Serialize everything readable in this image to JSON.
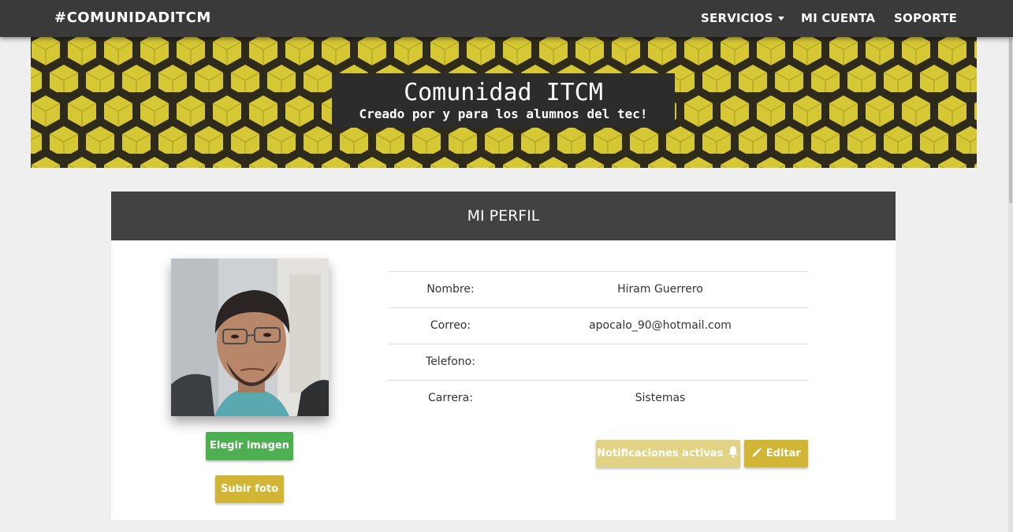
{
  "navbar": {
    "brand": "#COMUNIDADITCM",
    "items": [
      {
        "label": "SERVICIOS",
        "has_caret": true
      },
      {
        "label": "MI CUENTA"
      },
      {
        "label": "SOPORTE"
      }
    ]
  },
  "banner": {
    "title": "Comunidad ITCM",
    "subtitle": "Creado por y para los alumnos del tec!"
  },
  "profile": {
    "header": "MI PERFIL",
    "choose_image_label": "Elegir imagen",
    "upload_photo_label": "Subir foto",
    "fields": [
      {
        "label": "Nombre:",
        "value": "Hiram Guerrero"
      },
      {
        "label": "Correo:",
        "value": "apocalo_90@hotmail.com"
      },
      {
        "label": "Telefono:",
        "value": ""
      },
      {
        "label": "Carrera:",
        "value": "Sistemas"
      }
    ],
    "notifications_label": "Notificaciones activas",
    "edit_label": "Editar"
  },
  "colors": {
    "navbar": "#3a3a3a",
    "banner": "#d4c431",
    "green": "#4caf50",
    "gold": "#d2b535"
  },
  "icons": [
    "caret-down-icon",
    "bell-icon",
    "pencil-icon"
  ]
}
